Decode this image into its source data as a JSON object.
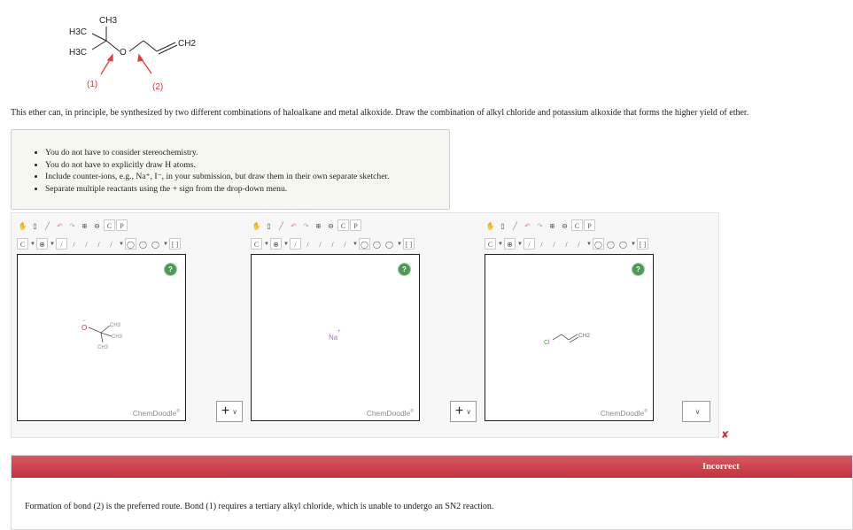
{
  "structure": {
    "labels": {
      "ch3_top": "CH3",
      "h3c_1": "H3C",
      "h3c_2": "H3C",
      "oxygen": "O",
      "ch2": "CH2"
    },
    "bond_labels": [
      "(1)",
      "(2)"
    ],
    "arrow_color": "#e63b3b"
  },
  "question": "This ether can, in principle, be synthesized by two different combinations of haloalkane and metal alkoxide. Draw the combination of alkyl chloride and potassium alkoxide that forms the higher yield of ether.",
  "hints": [
    "You do not have to consider stereochemistry.",
    "You do not have to explicitly draw H atoms.",
    "Include counter-ions, e.g., Na⁺, I⁻, in your submission, but draw them in their own separate sketcher.",
    "Separate multiple reactants using the + sign from the drop-down menu."
  ],
  "toolbar": {
    "row1": [
      "hand-icon",
      "clear-icon",
      "eraser-icon",
      "undo-icon",
      "redo-icon",
      "zoom-in-icon",
      "zoom-out-icon",
      "C",
      "P"
    ],
    "row1_sub": {
      "C": "copy",
      "P": "paste"
    },
    "row2": [
      "C",
      "⊕",
      "/",
      "/",
      "/",
      "/",
      "/",
      "◯",
      "◯",
      "◯",
      "[ ]"
    ]
  },
  "sketchers": [
    {
      "help": "?",
      "brand": "ChemDoodle",
      "brand_mark": "®",
      "molecule": {
        "o": "O",
        "ch3_a": "CH3",
        "ch3_b": "CH3",
        "ch3_c": "CH3",
        "charge": "−"
      },
      "operator": "+"
    },
    {
      "help": "?",
      "brand": "ChemDoodle",
      "brand_mark": "®",
      "molecule": {
        "ion": "Na",
        "charge": "+"
      },
      "operator": "+"
    },
    {
      "help": "?",
      "brand": "ChemDoodle",
      "brand_mark": "®",
      "molecule": {
        "cl": "Cl",
        "ch2": "CH2"
      },
      "operator": ""
    }
  ],
  "result": {
    "mark": "✘",
    "status": "Incorrect",
    "color": "#c9343f"
  },
  "feedback": "Formation of bond (2) is the preferred route. Bond (1) requires a tertiary alkyl chloride, which is unable to undergo an SN2 reaction."
}
